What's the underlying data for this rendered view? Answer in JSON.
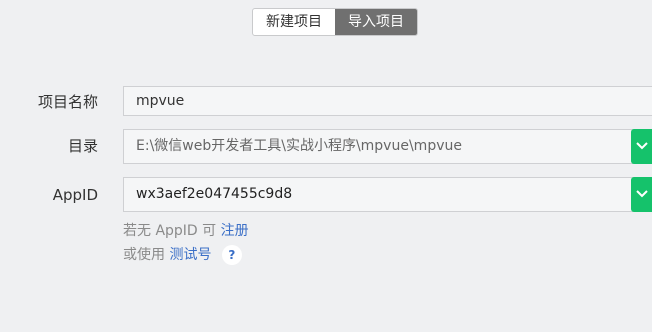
{
  "tabs": {
    "new_project": "新建项目",
    "import_project": "导入项目"
  },
  "form": {
    "name_label": "项目名称",
    "name_value": "mpvue",
    "dir_label": "目录",
    "dir_value": "E:\\微信web开发者工具\\实战小程序\\mpvue\\mpvue",
    "appid_label": "AppID",
    "appid_value": "wx3aef2e047455c9d8"
  },
  "hints": {
    "no_appid_prefix": "若无 AppID 可",
    "register_link": "注册",
    "or_use_prefix": "或使用",
    "test_account_link": "测试号",
    "help_glyph": "?"
  },
  "colors": {
    "accent_green": "#15c26b",
    "link_blue": "#3b6fc7",
    "active_tab": "#707070"
  },
  "icons": {
    "dropdown": "chevron-down-icon",
    "help": "help-icon"
  }
}
